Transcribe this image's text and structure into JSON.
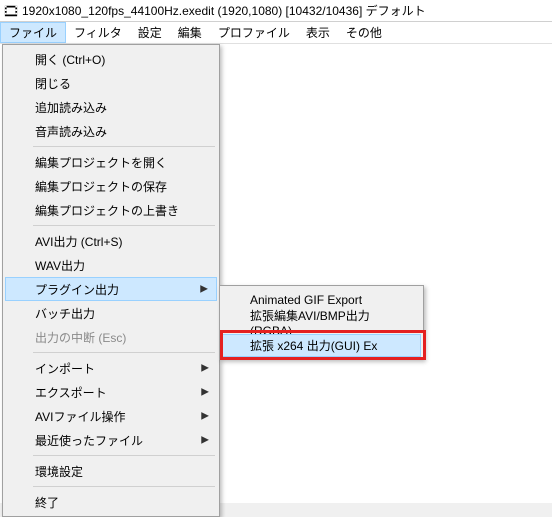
{
  "title": "1920x1080_120fps_44100Hz.exedit  (1920,1080)  [10432/10436]  デフォルト",
  "menubar": {
    "file": "ファイル",
    "filter": "フィルタ",
    "setting": "設定",
    "edit": "編集",
    "profile": "プロファイル",
    "view": "表示",
    "other": "その他"
  },
  "file_menu": {
    "open": "開く (Ctrl+O)",
    "close": "閉じる",
    "append_read": "追加読み込み",
    "audio_read": "音声読み込み",
    "open_project": "編集プロジェクトを開く",
    "save_project": "編集プロジェクトの保存",
    "overwrite_proj": "編集プロジェクトの上書き",
    "avi_out": "AVI出力 (Ctrl+S)",
    "wav_out": "WAV出力",
    "plugin_out": "プラグイン出力",
    "batch_out": "バッチ出力",
    "abort_output": "出力の中断 (Esc)",
    "import": "インポート",
    "export": "エクスポート",
    "avi_file_ops": "AVIファイル操作",
    "recent_files": "最近使ったファイル",
    "env_settings": "環境設定",
    "exit": "終了"
  },
  "plugin_submenu": {
    "animated_gif": "Animated GIF Export",
    "ext_avi_bmp": "拡張編集AVI/BMP出力 (RGBA)",
    "x264_gui_ex": "拡張 x264 出力(GUI) Ex"
  }
}
